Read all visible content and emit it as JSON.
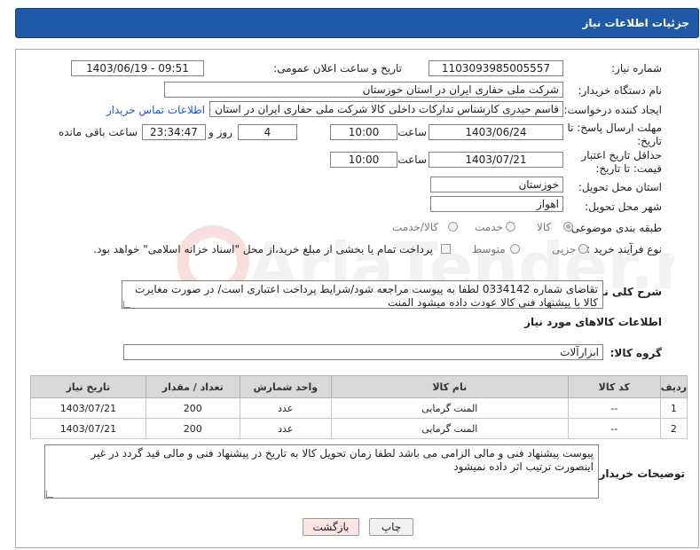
{
  "header": {
    "title": "جزئیات اطلاعات نیاز"
  },
  "form": {
    "need_number": {
      "label": "شماره نیاز:",
      "value": "1103093985005557"
    },
    "announce_datetime": {
      "label": "تاریخ و ساعت اعلان عمومی:",
      "value": "1403/06/19 - 09:51"
    },
    "buyer_org": {
      "label": "نام دستگاه خریدار:",
      "value": "شرکت ملی حفاری ایران در استان خوزستان"
    },
    "requester": {
      "label": "ایجاد کننده درخواست:",
      "value": "قاسم حیدری کارشناس تدارکات داخلی کالا شرکت ملی حفاری ایران در استان خوزستان",
      "contact_link": "اطلاعات تماس خریدار"
    },
    "reply_deadline": {
      "label": "مهلت ارسال پاسخ: تا تاریخ:",
      "date": "1403/06/24",
      "time_label": "ساعت",
      "time": "10:00",
      "days": "4",
      "days_label": "روز و",
      "remaining": "23:34:47",
      "remaining_label": "ساعت باقی مانده"
    },
    "price_validity": {
      "label": "حداقل تاریخ اعتبار قیمت: تا تاریخ:",
      "date": "1403/07/21",
      "time_label": "ساعت",
      "time": "10:00"
    },
    "delivery_province": {
      "label": "استان محل تحویل:",
      "value": "خوزستان"
    },
    "delivery_city": {
      "label": "شهر محل تحویل:",
      "value": "اهواز"
    },
    "category": {
      "label": "طبقه بندی موضوعی:",
      "options": [
        "کالا",
        "خدمت",
        "کالا/خدمت"
      ],
      "selected": "کالا"
    },
    "process_type": {
      "label": "نوع فرآیند خرید :",
      "options": [
        "جزیی",
        "متوسط"
      ],
      "payment_note": "پرداخت تمام یا بخشی از مبلغ خرید،از محل \"اسناد خزانه اسلامی\" خواهد بود."
    },
    "summary": {
      "label": "شرح کلی نیاز:",
      "value": "تقاضای شماره 0334142 لطفا به پیوست مراجعه شود/شرایط پرداخت اعتباری است/ در صورت مغایرت کالا با پیشنهاد فنی کالا عودت داده میشود المنت"
    }
  },
  "goods": {
    "section_title": "اطلاعات کالاهای مورد نیاز",
    "group_label": "گروه کالا:",
    "group_value": "ابزارآلات",
    "columns": [
      "ردیف",
      "کد کالا",
      "نام کالا",
      "واحد شمارش",
      "تعداد / مقدار",
      "تاریخ نیاز"
    ],
    "rows": [
      [
        "1",
        "--",
        "المنت گرمایی",
        "عدد",
        "200",
        "1403/07/21"
      ],
      [
        "2",
        "--",
        "المنت گرمایی",
        "عدد",
        "200",
        "1403/07/21"
      ]
    ]
  },
  "buyer_notes": {
    "label": "توضیحات خریدار:",
    "value": "پیوست پیشنهاد فنی و مالی الزامی می باشد لطفا زمان تحویل کالا به تاریخ در پیشنهاد فنی و مالی قید گردد در غیر اینصورت ترتیب اثر داده نمیشود"
  },
  "buttons": {
    "print": "چاپ",
    "back": "بازگشت"
  },
  "watermark": {
    "text": "AriaTender.neT"
  },
  "colors": {
    "header_bg": "#1e5aa8",
    "table_header_bg": "#d9d9d9",
    "link": "#1a56c6",
    "back_button_bg": "#fde4e4"
  }
}
